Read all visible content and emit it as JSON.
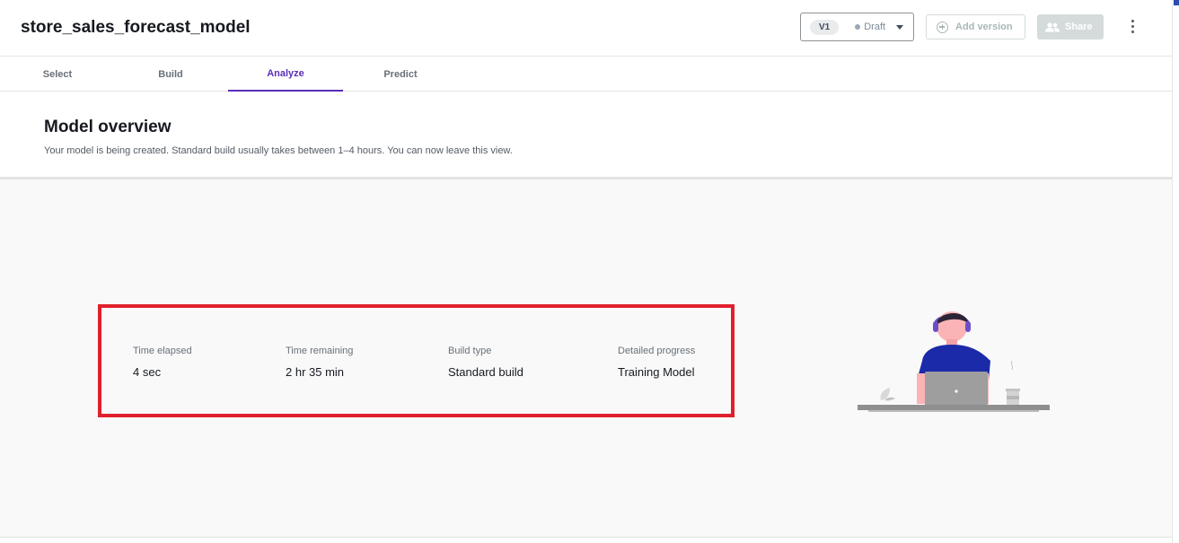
{
  "header": {
    "title": "store_sales_forecast_model",
    "version": "V1",
    "status": "Draft",
    "add_version_label": "Add version",
    "share_label": "Share"
  },
  "tabs": [
    {
      "label": "Select",
      "active": false
    },
    {
      "label": "Build",
      "active": false
    },
    {
      "label": "Analyze",
      "active": true
    },
    {
      "label": "Predict",
      "active": false
    }
  ],
  "overview": {
    "title": "Model overview",
    "description": "Your model is being created. Standard build usually takes between 1–4 hours. You can now leave this view."
  },
  "stats": [
    {
      "label": "Time elapsed",
      "value": "4 sec"
    },
    {
      "label": "Time remaining",
      "value": "2 hr 35 min"
    },
    {
      "label": "Build type",
      "value": "Standard build"
    },
    {
      "label": "Detailed progress",
      "value": "Training Model"
    }
  ],
  "colors": {
    "accent": "#5a2eb8",
    "highlight_border": "#e0202c",
    "figure_shirt": "#1a2aa8",
    "figure_skin": "#fbb4b6"
  }
}
